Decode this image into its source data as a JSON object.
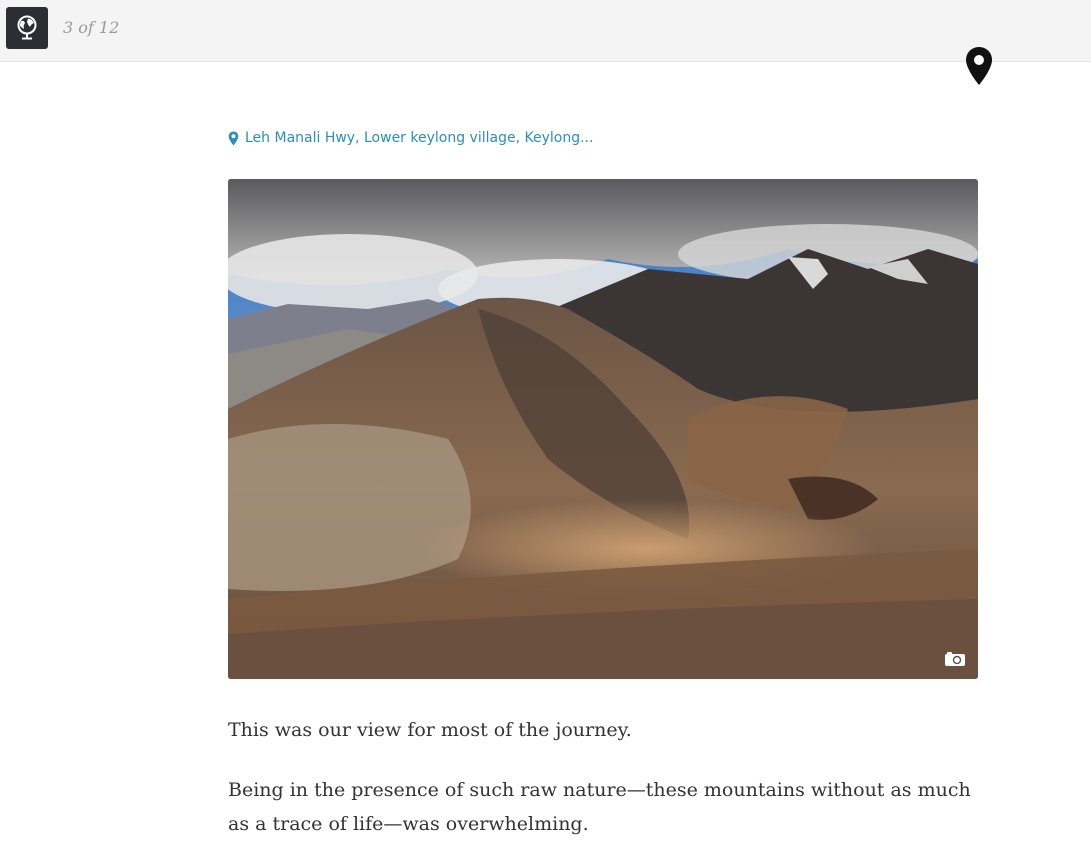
{
  "header": {
    "logo_icon": "globe-trophy-icon",
    "counter": "3 of 12",
    "map_icon": "map-pin-icon"
  },
  "entry": {
    "location": "Leh Manali Hwy, Lower keylong village, Keylong...",
    "location_icon": "location-pin-icon",
    "photo_icon": "camera-icon",
    "paragraphs": [
      "This was our view for most of the journey.",
      "Being in the presence of such raw nature—these mountains without as much as a trace of life—was overwhelming."
    ]
  },
  "colors": {
    "accent": "#2b8fb8",
    "topbar": "#f4f4f4",
    "logo_bg": "#2b2f33",
    "text": "#333333"
  }
}
